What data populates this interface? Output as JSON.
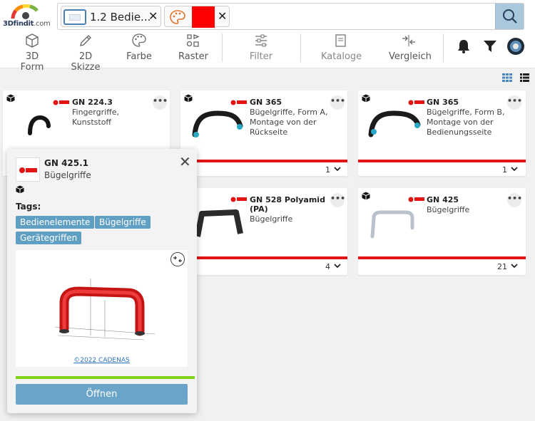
{
  "logo": {
    "brand": "3Dfindit",
    "tld": ".com"
  },
  "search": {
    "category_chip": {
      "label": "1.2 Bedie...",
      "icon": "catalog-category-icon"
    },
    "color_chip": {
      "icon": "palette-icon",
      "color": "#ff0000"
    },
    "search_icon": "search-icon"
  },
  "toolbar": {
    "form3d": "3D Form",
    "sketch2d": "2D Skizze",
    "color": "Farbe",
    "grid": "Raster",
    "filter": "Filter",
    "catalogs": "Kataloge",
    "compare": "Vergleich"
  },
  "colors": {
    "accent_red": "#e21414",
    "button_blue": "#6ba4c9",
    "tag_blue": "#5f9fc4",
    "progress_green": "#7fd41a"
  },
  "cards": [
    {
      "title": "GN 224.3",
      "desc": [
        "Fingergriffe,",
        "Kunststoff"
      ],
      "count": ""
    },
    {
      "title": "GN 365",
      "desc": [
        "Bügelgriffe, Form A,",
        "Montage von der",
        "Rückseite"
      ],
      "count": "1"
    },
    {
      "title": "GN 365",
      "desc": [
        "Bügelgriffe, Form B,",
        "Montage von der",
        "Bedienungsseite"
      ],
      "count": "1"
    },
    {
      "title": "GN 528 Polyamid",
      "title2": "(PA)",
      "desc": [
        "Bügelgriffe"
      ],
      "count": "4"
    },
    {
      "title": "GN 425",
      "desc": [
        "Bügelgriffe"
      ],
      "count": "21"
    }
  ],
  "popover": {
    "title": "GN 425.1",
    "subtitle": "Bügelgriffe",
    "tags_label": "Tags:",
    "tags": [
      "Bedienelemente",
      "Bügelgriffe",
      "Gerätegriffen"
    ],
    "copyright": "©2022 CADENAS",
    "open_label": "Öffnen"
  }
}
